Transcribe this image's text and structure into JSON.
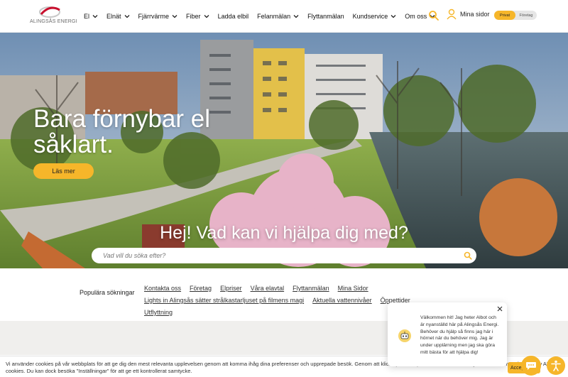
{
  "brand": {
    "name": "ALINGSÅS ENERGI",
    "accent": "#f6b62a",
    "logo_red": "#c8102e"
  },
  "nav": {
    "items": [
      {
        "label": "El",
        "dropdown": true
      },
      {
        "label": "Elnät",
        "dropdown": true
      },
      {
        "label": "Fjärrvärme",
        "dropdown": true
      },
      {
        "label": "Fiber",
        "dropdown": true
      },
      {
        "label": "Ladda elbil",
        "dropdown": false
      },
      {
        "label": "Felanmälan",
        "dropdown": true
      },
      {
        "label": "Flyttanmälan",
        "dropdown": false
      },
      {
        "label": "Kundservice",
        "dropdown": true
      },
      {
        "label": "Om oss",
        "dropdown": true
      }
    ],
    "search_icon": "search-icon",
    "mina_sidor": "Mina sidor",
    "toggle": {
      "private": "Privat",
      "business": "Företag",
      "selected": "Privat"
    }
  },
  "hero": {
    "title": "Bara förnybar el såklart.",
    "cta": "Läs mer",
    "help_title": "Hej! Vad kan vi hjälpa dig med?",
    "search_placeholder": "Vad vill du söka efter?"
  },
  "popular": {
    "label": "Populära sökningar",
    "links": [
      "Kontakta oss",
      "Företag",
      "Elpriser",
      "Våra elavtal",
      "Flyttanmälan",
      "Mina Sidor",
      "Lights in Alingsås sätter strålkastarljuset på filmens magi",
      "Aktuella vattennivåer",
      "Öppettider",
      "Utflyttning"
    ]
  },
  "cookie": {
    "text": "Vi använder cookies på vår webbplats för att ge dig den mest relevanta upplevelsen genom att komma ihåg dina preferenser och upprepade besök. Genom att klicka på \"Acceptera alla cookies\" samtycker du till användningen av ALLA cookies. Du kan dock besöka \"Inställningar\" för att ge ett kontrollerat samtycke.",
    "accept": "Acceptera alla cookies"
  },
  "chat": {
    "message": "Välkommen hit! Jag heter Albot och är nyanställd här på Alingsås Energi. Behöver du hjälp så finns jag här i hörnet när du behöver mig. Jag är under upplärning men jag ska göra mitt bästa för att hjälpa dig!"
  }
}
